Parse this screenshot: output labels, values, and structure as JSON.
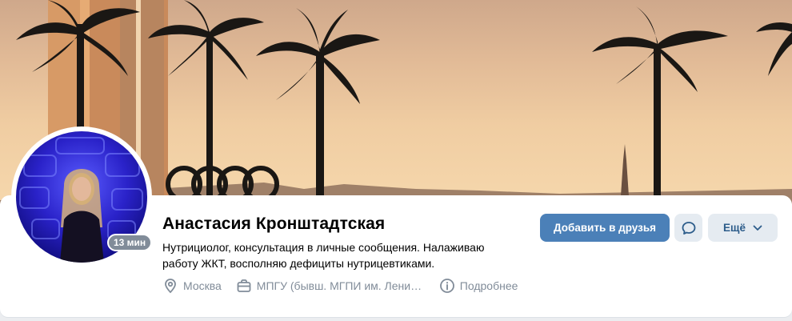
{
  "profile": {
    "name": "Анастасия Кронштадтская",
    "status": "Нутрициолог, консультация в личные сообщения. Налаживаю работу ЖКТ, восполняю дефициты нутрицевтиками.",
    "online": "13 мин"
  },
  "info": {
    "city": "Москва",
    "university": "МПГУ (бывш. МГПИ им. Ленина)",
    "details": "Подробнее"
  },
  "actions": {
    "add_friend": "Добавить в друзья",
    "more": "Ещё"
  },
  "colors": {
    "primary_button": "#4b80b8",
    "secondary_button": "#e5ebf1",
    "secondary_text": "#818c99"
  },
  "icons": [
    "location-pin-icon",
    "briefcase-icon",
    "info-icon",
    "message-icon",
    "chevron-down-icon"
  ]
}
